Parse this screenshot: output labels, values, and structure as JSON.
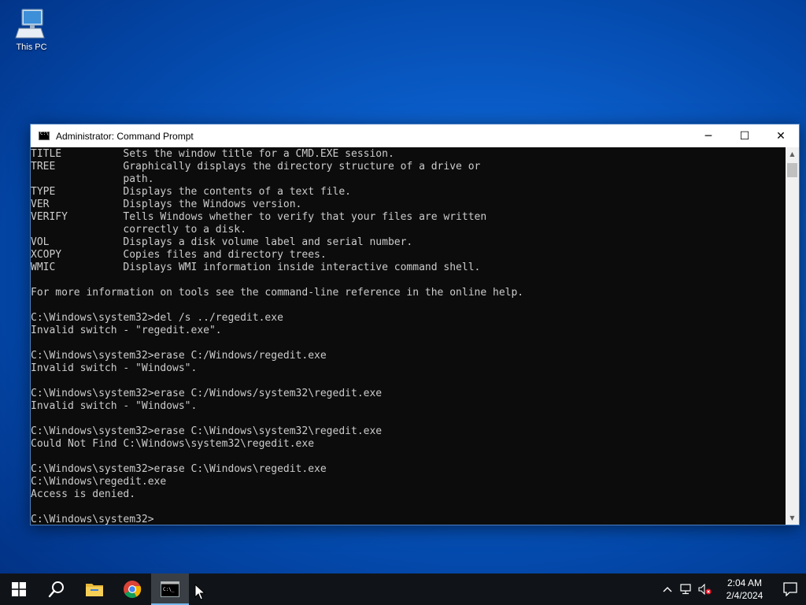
{
  "desktop": {
    "icons": [
      {
        "label": "This PC",
        "icon": "computer-icon"
      }
    ]
  },
  "window": {
    "title": "Administrator: Command Prompt",
    "icon": "cmd-icon",
    "controls": {
      "minimize": "─",
      "maximize": "☐",
      "close": "✕"
    },
    "console_lines": [
      "TITLE          Sets the window title for a CMD.EXE session.",
      "TREE           Graphically displays the directory structure of a drive or",
      "               path.",
      "TYPE           Displays the contents of a text file.",
      "VER            Displays the Windows version.",
      "VERIFY         Tells Windows whether to verify that your files are written",
      "               correctly to a disk.",
      "VOL            Displays a disk volume label and serial number.",
      "XCOPY          Copies files and directory trees.",
      "WMIC           Displays WMI information inside interactive command shell.",
      "",
      "For more information on tools see the command-line reference in the online help.",
      "",
      "C:\\Windows\\system32>del /s ../regedit.exe",
      "Invalid switch - \"regedit.exe\".",
      "",
      "C:\\Windows\\system32>erase C:/Windows/regedit.exe",
      "Invalid switch - \"Windows\".",
      "",
      "C:\\Windows\\system32>erase C:/Windows/system32\\regedit.exe",
      "Invalid switch - \"Windows\".",
      "",
      "C:\\Windows\\system32>erase C:\\Windows\\system32\\regedit.exe",
      "Could Not Find C:\\Windows\\system32\\regedit.exe",
      "",
      "C:\\Windows\\system32>erase C:\\Windows\\regedit.exe",
      "C:\\Windows\\regedit.exe",
      "Access is denied.",
      "",
      "C:\\Windows\\system32>"
    ]
  },
  "taskbar": {
    "items": [
      {
        "name": "start",
        "icon": "windows-logo-icon"
      },
      {
        "name": "search",
        "icon": "search-icon"
      },
      {
        "name": "file-explorer",
        "icon": "folder-icon"
      },
      {
        "name": "chrome",
        "icon": "chrome-icon"
      },
      {
        "name": "command-prompt",
        "icon": "cmd-icon",
        "active": true
      }
    ],
    "tray": {
      "icons": [
        "chevron-up-icon",
        "network-icon",
        "volume-muted-icon"
      ],
      "time": "2:04 AM",
      "date": "2/4/2024",
      "notification_icon": "notification-icon"
    }
  },
  "colors": {
    "console_bg": "#0c0c0c",
    "console_fg": "#cccccc",
    "taskbar_bg": "#101418",
    "accent": "#76b9ed"
  }
}
